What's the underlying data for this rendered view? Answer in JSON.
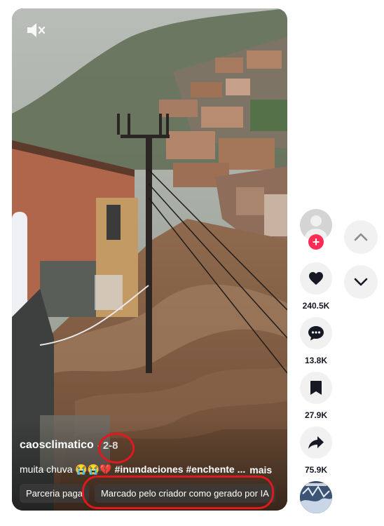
{
  "video": {
    "author": "caosclimatico",
    "separator": "·",
    "date": "2-8",
    "caption_text": "muita chuva 😭😭💔",
    "caption_tags": "#inundaciones #enchente ...",
    "more_label": "mais",
    "paid_partnership_label": "Parceria paga",
    "ai_label": "Marcado pelo criador como gerado por IA"
  },
  "actions": {
    "likes": "240.5K",
    "comments": "13.8K",
    "saves": "27.9K",
    "shares": "75.9K"
  },
  "icons": {
    "mute": "speaker-muted-icon",
    "follow": "plus-icon",
    "like": "heart-icon",
    "comment": "comment-bubble-icon",
    "save": "bookmark-icon",
    "share": "share-arrow-icon",
    "prev": "chevron-up-icon",
    "next": "chevron-down-icon"
  },
  "colors": {
    "follow_accent": "#fe2c55",
    "highlight": "#e0181f",
    "button_bg": "#f1f1f2"
  }
}
